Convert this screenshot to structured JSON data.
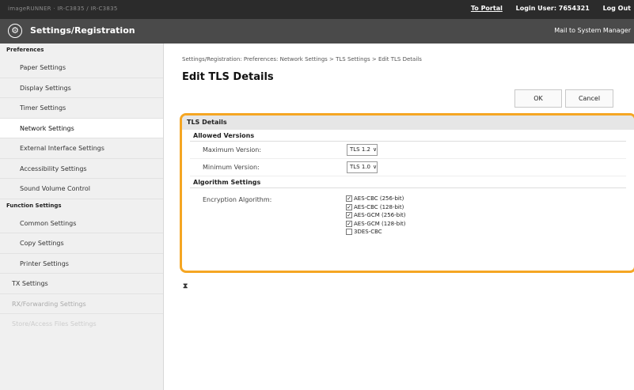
{
  "topbar": {
    "device_name": "imageRUNNER  ·  IR-C3835  /  IR-C3835",
    "to_portal": "To Portal",
    "login_user": "Login User:  7654321",
    "log_out": "Log Out"
  },
  "titlebar": {
    "icon": "settings-gear-icon",
    "title": "Settings/Registration",
    "mail": "Mail to System Manager"
  },
  "sidebar": {
    "preferences_heading": "Preferences",
    "preferences_items": [
      "Paper Settings",
      "Display Settings",
      "Timer Settings",
      "Network Settings",
      "External Interface Settings",
      "Accessibility Settings",
      "Sound Volume Control"
    ],
    "function_heading": "Function Settings",
    "function_items": [
      "Common Settings",
      "Copy Settings",
      "Printer Settings"
    ],
    "other_items": [
      "TX Settings",
      "RX/Forwarding Settings",
      "Store/Access Files Settings"
    ]
  },
  "main": {
    "breadcrumb": "Settings/Registration: Preferences: Network Settings > TLS Settings > Edit TLS Details",
    "title": "Edit TLS Details",
    "ok_label": "OK",
    "cancel_label": "Cancel",
    "panel_title": "TLS Details",
    "allowed_versions_heading": "Allowed Versions",
    "max_version_label": "Maximum Version:",
    "max_version_value": "TLS 1.2",
    "min_version_label": "Minimum Version:",
    "min_version_value": "TLS 1.0",
    "algorithm_heading": "Algorithm Settings",
    "encryption_label": "Encryption Algorithm:",
    "algorithms": [
      {
        "label": "AES-CBC (256-bit)",
        "checked": true
      },
      {
        "label": "AES-CBC (128-bit)",
        "checked": true
      },
      {
        "label": "AES-GCM (256-bit)",
        "checked": true
      },
      {
        "label": "AES-GCM (128-bit)",
        "checked": true
      },
      {
        "label": "3DES-CBC",
        "checked": false
      }
    ],
    "back_to_top_icon": "back-to-top-icon"
  },
  "colors": {
    "highlight": "#f5a623",
    "topbar": "#2b2b2b",
    "titlebar": "#4a4a4a"
  }
}
